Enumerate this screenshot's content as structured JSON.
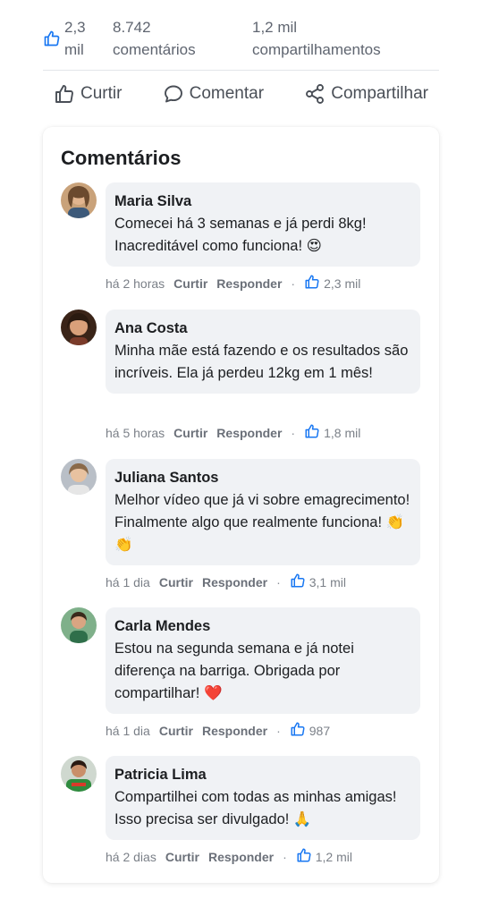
{
  "stats": {
    "likes": "2,3\nmil",
    "comments": "8.742\ncomentários",
    "shares": "1,2 mil\ncompartilhamentos"
  },
  "actions": {
    "like": "Curtir",
    "comment": "Comentar",
    "share": "Compartilhar"
  },
  "section_title": "Comentários",
  "labels": {
    "like": "Curtir",
    "reply": "Responder",
    "dot": "·"
  },
  "comments": [
    {
      "author": "Maria Silva",
      "text": "Comecei há 3 semanas e já perdi 8kg! Inacreditável como funciona! 😍",
      "time": "há 2 horas",
      "likes": "2,3 mil"
    },
    {
      "author": "Ana Costa",
      "text": "Minha mãe está fazendo e os resultados são incríveis. Ela já perdeu 12kg em 1 mês!",
      "time": "há 5 horas",
      "likes": "1,8 mil"
    },
    {
      "author": "Juliana Santos",
      "text": "Melhor vídeo que já vi sobre emagrecimento! Finalmente algo que realmente funciona! 👏👏",
      "time": "há 1 dia",
      "likes": "3,1 mil"
    },
    {
      "author": "Carla Mendes",
      "text": "Estou na segunda semana e já notei diferença na barriga. Obrigada por compartilhar! ❤️",
      "time": "há 1 dia",
      "likes": "987"
    },
    {
      "author": "Patricia Lima",
      "text": "Compartilhei com todas as minhas amigas! Isso precisa ser divulgado! 🙏",
      "time": "há 2 dias",
      "likes": "1,2 mil"
    }
  ],
  "colors": {
    "accent": "#1877f2",
    "bubble": "#f0f2f5",
    "muted": "#7b8088"
  },
  "icons": [
    "thumbs-up-icon",
    "comment-icon",
    "share-icon"
  ]
}
